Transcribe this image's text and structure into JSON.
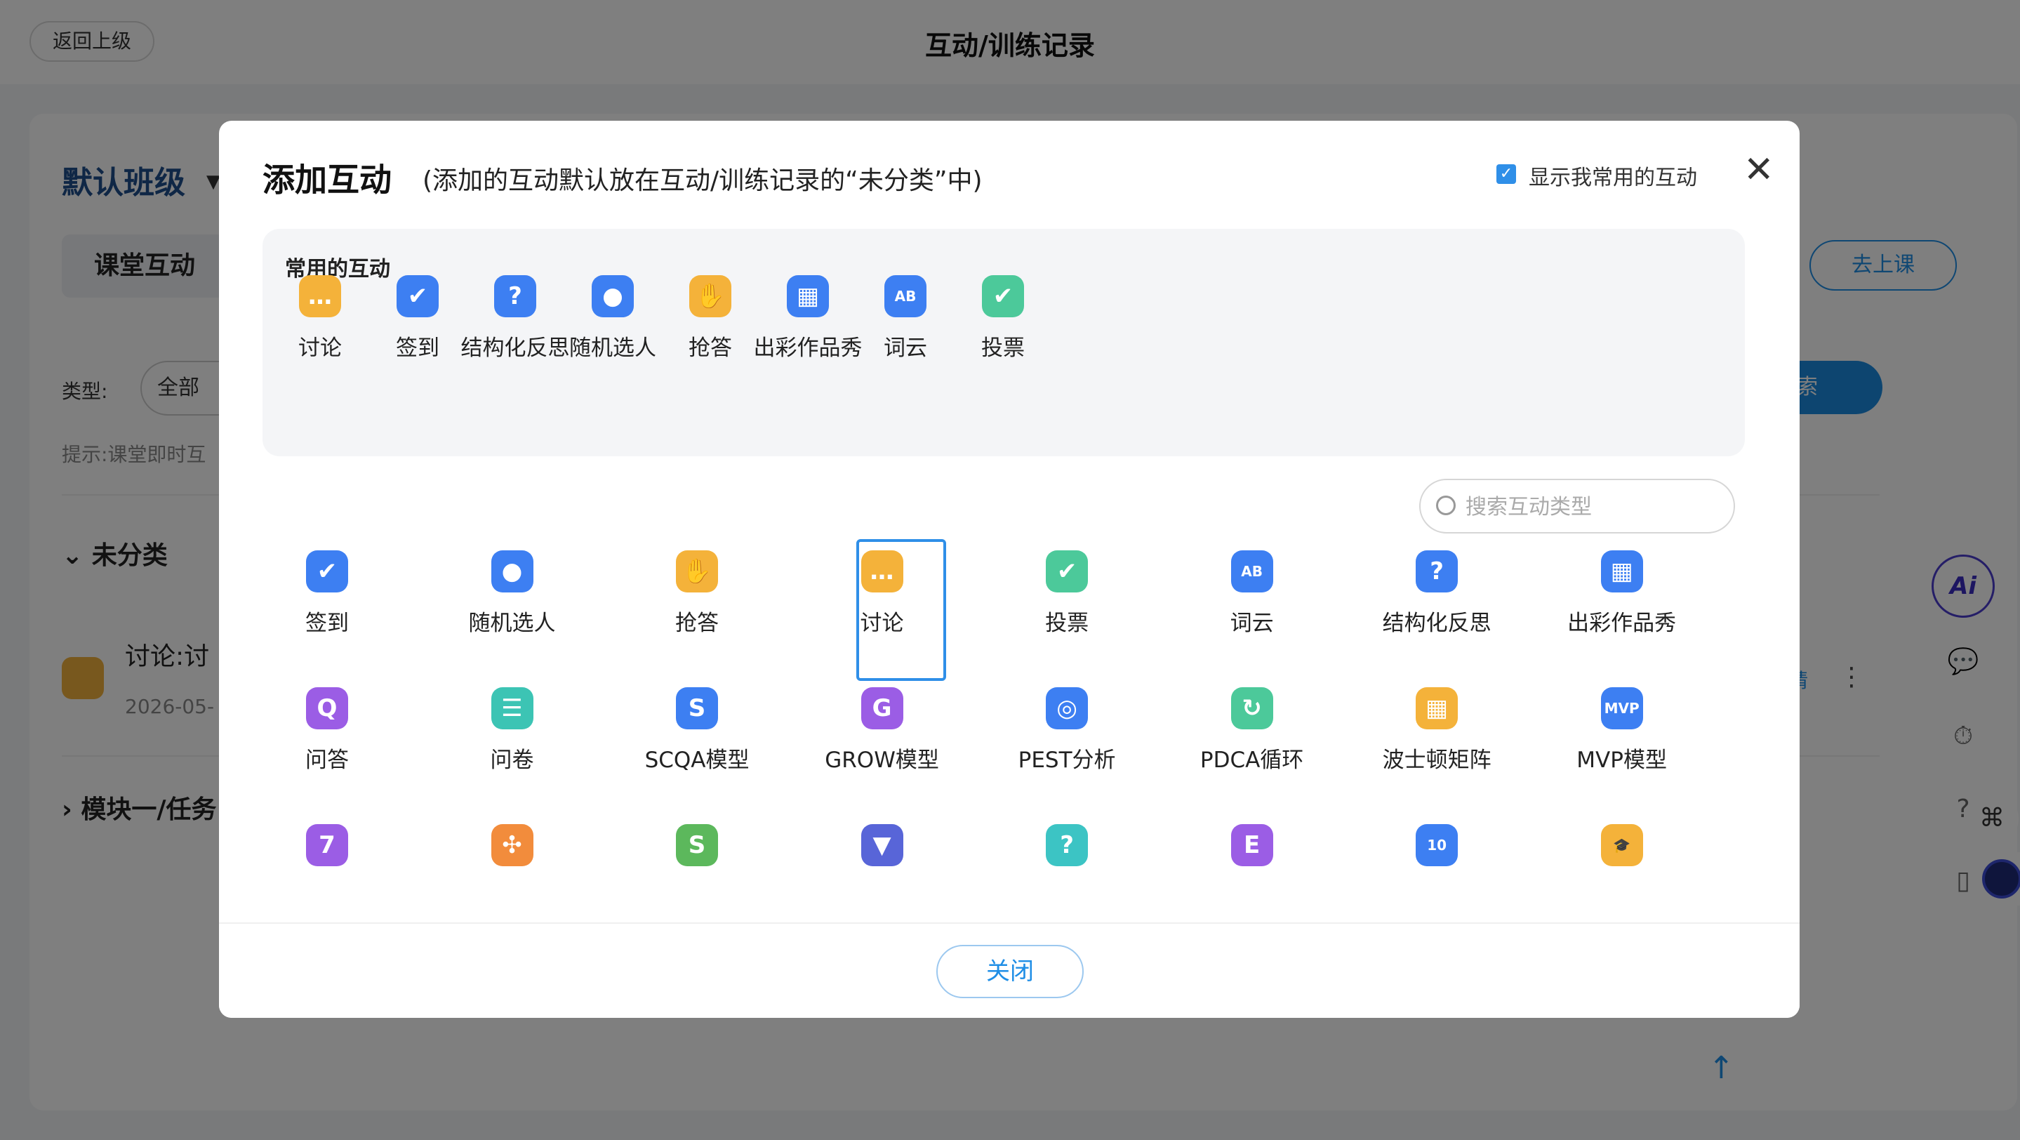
{
  "header": {
    "back_label": "返回上级",
    "title": "互动/训练记录"
  },
  "page": {
    "class_name": "默认班级",
    "tab_label": "课堂互动",
    "go_class_label": "去上课",
    "type_label": "类型:",
    "type_value": "全部",
    "search_label": "索",
    "hint": "提示:课堂即时互",
    "section_uncategorized": "未分类",
    "item_title": "讨论:讨",
    "item_date": "2026-05-",
    "item_edit": "请",
    "section_module": "模块一/任务",
    "ai_label": "Ai"
  },
  "modal": {
    "title": "添加互动",
    "subtitle": "(添加的互动默认放在互动/训练记录的“未分类”中)",
    "show_common_label": "显示我常用的互动",
    "common_title": "常用的互动",
    "common_items": [
      {
        "label": "讨论",
        "icon": "chat-bubble-icon",
        "color": "#f4b23a"
      },
      {
        "label": "签到",
        "icon": "checkin-shield-icon",
        "color": "#3d7ff2"
      },
      {
        "label": "结构化反思",
        "icon": "question-icon",
        "color": "#3d7ff2"
      },
      {
        "label": "随机选人",
        "icon": "random-person-icon",
        "color": "#3d7ff2"
      },
      {
        "label": "抢答",
        "icon": "raise-hand-icon",
        "color": "#f4b23a"
      },
      {
        "label": "出彩作品秀",
        "icon": "gallery-grid-icon",
        "color": "#3d7ff2"
      },
      {
        "label": "词云",
        "icon": "word-cloud-icon",
        "color": "#3d7ff2"
      },
      {
        "label": "投票",
        "icon": "vote-check-icon",
        "color": "#4cc99a"
      }
    ],
    "search_placeholder": "搜索互动类型",
    "all_items": [
      {
        "label": "签到",
        "icon": "checkin-shield-icon",
        "color": "#3d7ff2",
        "glyph": "✔"
      },
      {
        "label": "随机选人",
        "icon": "random-person-icon",
        "color": "#3d7ff2",
        "glyph": "●"
      },
      {
        "label": "抢答",
        "icon": "raise-hand-icon",
        "color": "#f4b23a",
        "glyph": "✋"
      },
      {
        "label": "讨论",
        "icon": "chat-bubble-icon",
        "color": "#f4b23a",
        "glyph": "…"
      },
      {
        "label": "投票",
        "icon": "vote-check-icon",
        "color": "#4cc99a",
        "glyph": "✔"
      },
      {
        "label": "词云",
        "icon": "word-cloud-icon",
        "color": "#3d7ff2",
        "glyph": "AB"
      },
      {
        "label": "结构化反思",
        "icon": "question-icon",
        "color": "#3d7ff2",
        "glyph": "?"
      },
      {
        "label": "出彩作品秀",
        "icon": "gallery-grid-icon",
        "color": "#3d7ff2",
        "glyph": "▦"
      },
      {
        "label": "问答",
        "icon": "qa-icon",
        "color": "#9b5de5",
        "glyph": "Q"
      },
      {
        "label": "问卷",
        "icon": "questionnaire-icon",
        "color": "#3cc4b4",
        "glyph": "☰"
      },
      {
        "label": "SCQA模型",
        "icon": "scqa-icon",
        "color": "#3d7ff2",
        "glyph": "S"
      },
      {
        "label": "GROW模型",
        "icon": "grow-icon",
        "color": "#9b5de5",
        "glyph": "G"
      },
      {
        "label": "PEST分析",
        "icon": "pest-icon",
        "color": "#3d7ff2",
        "glyph": "◎"
      },
      {
        "label": "PDCA循环",
        "icon": "pdca-cycle-icon",
        "color": "#4cc99a",
        "glyph": "↻"
      },
      {
        "label": "波士顿矩阵",
        "icon": "boston-matrix-icon",
        "color": "#f4b23a",
        "glyph": "▦"
      },
      {
        "label": "MVP模型",
        "icon": "mvp-icon",
        "color": "#3d7ff2",
        "glyph": "MVP"
      },
      {
        "label": "",
        "icon": "seven-icon",
        "color": "#9b5de5",
        "glyph": "7"
      },
      {
        "label": "",
        "icon": "network-icon",
        "color": "#f28c3c",
        "glyph": "✣"
      },
      {
        "label": "",
        "icon": "pentagon-s-icon",
        "color": "#5cb85c",
        "glyph": "S"
      },
      {
        "label": "",
        "icon": "funnel-icon",
        "color": "#5865d8",
        "glyph": "▼"
      },
      {
        "label": "",
        "icon": "question-teal-icon",
        "color": "#3cc4c4",
        "glyph": "?"
      },
      {
        "label": "",
        "icon": "e-letter-icon",
        "color": "#9b5de5",
        "glyph": "E"
      },
      {
        "label": "",
        "icon": "ten-icon",
        "color": "#3d7ff2",
        "glyph": "10"
      },
      {
        "label": "",
        "icon": "graduation-cap-icon",
        "color": "#f4b23a",
        "glyph": "🎓"
      }
    ],
    "close_label": "关闭"
  }
}
